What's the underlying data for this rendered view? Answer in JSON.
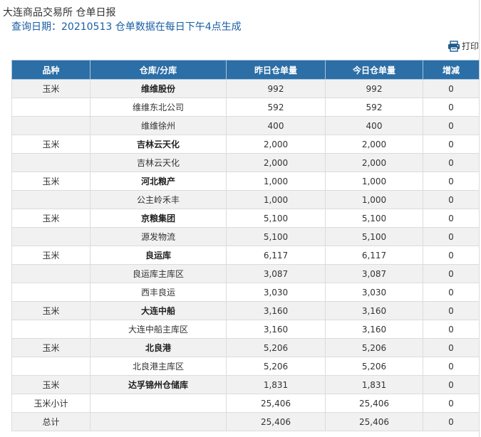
{
  "header": {
    "title": "大连商品交易所 仓单日报",
    "subtitle": "查询日期：20210513 仓单数据在每日下午4点生成"
  },
  "toolbar": {
    "print_label": "打印",
    "print_icon": "printer-icon"
  },
  "table": {
    "columns": [
      "品种",
      "仓库/分库",
      "昨日仓单量",
      "今日仓单量",
      "增减"
    ],
    "rows": [
      {
        "variety": "玉米",
        "warehouse": "维维股份",
        "yesterday": "992",
        "today": "992",
        "change": "0",
        "bold": true
      },
      {
        "variety": "",
        "warehouse": "维维东北公司",
        "yesterday": "592",
        "today": "592",
        "change": "0",
        "bold": false
      },
      {
        "variety": "",
        "warehouse": "维维徐州",
        "yesterday": "400",
        "today": "400",
        "change": "0",
        "bold": false
      },
      {
        "variety": "玉米",
        "warehouse": "吉林云天化",
        "yesterday": "2,000",
        "today": "2,000",
        "change": "0",
        "bold": true
      },
      {
        "variety": "",
        "warehouse": "吉林云天化",
        "yesterday": "2,000",
        "today": "2,000",
        "change": "0",
        "bold": false
      },
      {
        "variety": "玉米",
        "warehouse": "河北粮产",
        "yesterday": "1,000",
        "today": "1,000",
        "change": "0",
        "bold": true
      },
      {
        "variety": "",
        "warehouse": "公主岭禾丰",
        "yesterday": "1,000",
        "today": "1,000",
        "change": "0",
        "bold": false
      },
      {
        "variety": "玉米",
        "warehouse": "京粮集团",
        "yesterday": "5,100",
        "today": "5,100",
        "change": "0",
        "bold": true
      },
      {
        "variety": "",
        "warehouse": "源发物流",
        "yesterday": "5,100",
        "today": "5,100",
        "change": "0",
        "bold": false
      },
      {
        "variety": "玉米",
        "warehouse": "良运库",
        "yesterday": "6,117",
        "today": "6,117",
        "change": "0",
        "bold": true
      },
      {
        "variety": "",
        "warehouse": "良运库主库区",
        "yesterday": "3,087",
        "today": "3,087",
        "change": "0",
        "bold": false
      },
      {
        "variety": "",
        "warehouse": "西丰良运",
        "yesterday": "3,030",
        "today": "3,030",
        "change": "0",
        "bold": false
      },
      {
        "variety": "玉米",
        "warehouse": "大连中船",
        "yesterday": "3,160",
        "today": "3,160",
        "change": "0",
        "bold": true
      },
      {
        "variety": "",
        "warehouse": "大连中船主库区",
        "yesterday": "3,160",
        "today": "3,160",
        "change": "0",
        "bold": false
      },
      {
        "variety": "玉米",
        "warehouse": "北良港",
        "yesterday": "5,206",
        "today": "5,206",
        "change": "0",
        "bold": true
      },
      {
        "variety": "",
        "warehouse": "北良港主库区",
        "yesterday": "5,206",
        "today": "5,206",
        "change": "0",
        "bold": false
      },
      {
        "variety": "玉米",
        "warehouse": "达孚锦州仓储库",
        "yesterday": "1,831",
        "today": "1,831",
        "change": "0",
        "bold": true
      },
      {
        "variety": "玉米小计",
        "warehouse": "",
        "yesterday": "25,406",
        "today": "25,406",
        "change": "0",
        "bold": false
      },
      {
        "variety": "总计",
        "warehouse": "",
        "yesterday": "25,406",
        "today": "25,406",
        "change": "0",
        "bold": false
      }
    ]
  },
  "colors": {
    "header_bg": "#2c6ea6",
    "subtitle": "#1a5fa6",
    "alt_row": "#f1f1f1"
  }
}
